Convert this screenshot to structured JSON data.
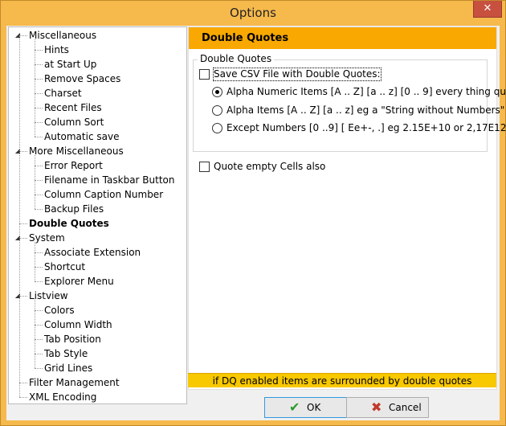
{
  "window": {
    "title": "Options"
  },
  "tree": {
    "items": [
      {
        "label": "Miscellaneous",
        "level": 0,
        "expander": "minus"
      },
      {
        "label": "Hints",
        "level": 1
      },
      {
        "label": "at Start Up",
        "level": 1
      },
      {
        "label": "Remove Spaces",
        "level": 1
      },
      {
        "label": "Charset",
        "level": 1
      },
      {
        "label": "Recent Files",
        "level": 1
      },
      {
        "label": "Column Sort",
        "level": 1
      },
      {
        "label": "Automatic save",
        "level": 1
      },
      {
        "label": "More Miscellaneous",
        "level": 0,
        "expander": "minus"
      },
      {
        "label": "Error Report",
        "level": 1
      },
      {
        "label": "Filename in Taskbar Button",
        "level": 1
      },
      {
        "label": "Column Caption Number",
        "level": 1
      },
      {
        "label": "Backup Files",
        "level": 1
      },
      {
        "label": "Double Quotes",
        "level": 0,
        "selected": true
      },
      {
        "label": "System",
        "level": 0,
        "expander": "minus"
      },
      {
        "label": "Associate Extension",
        "level": 1
      },
      {
        "label": "Shortcut",
        "level": 1
      },
      {
        "label": "Explorer Menu",
        "level": 1
      },
      {
        "label": "Listview",
        "level": 0,
        "expander": "minus"
      },
      {
        "label": "Colors",
        "level": 1
      },
      {
        "label": "Column Width",
        "level": 1
      },
      {
        "label": "Tab Position",
        "level": 1
      },
      {
        "label": "Tab Style",
        "level": 1
      },
      {
        "label": "Grid Lines",
        "level": 1
      },
      {
        "label": "Filter Management",
        "level": 0
      },
      {
        "label": "XML Encoding",
        "level": 0
      }
    ]
  },
  "panel": {
    "header": "Double Quotes",
    "group_title": "Double Quotes",
    "save_checkbox_label": "Save CSV File with Double Quotes:",
    "radio_alpha_numeric": "Alpha Numeric Items  [A .. Z]  [a .. z]  [0 .. 9]  every thing quote",
    "radio_alpha": "Alpha Items [A .. Z]  [a .. z]   eg a \"String without Numbers\"",
    "radio_except_numbers": "Except Numbers [0 ..9] [ Ee+-, .]   eg  2.15E+10 or 2,17E12",
    "quote_empty_label": "Quote empty Cells also",
    "footer_note": "if DQ enabled items are surrounded by double quotes"
  },
  "buttons": {
    "ok": "OK",
    "cancel": "Cancel"
  },
  "colors": {
    "accent": "#f8a800",
    "frame": "#f6b94c",
    "note_bar": "#f8c800"
  }
}
